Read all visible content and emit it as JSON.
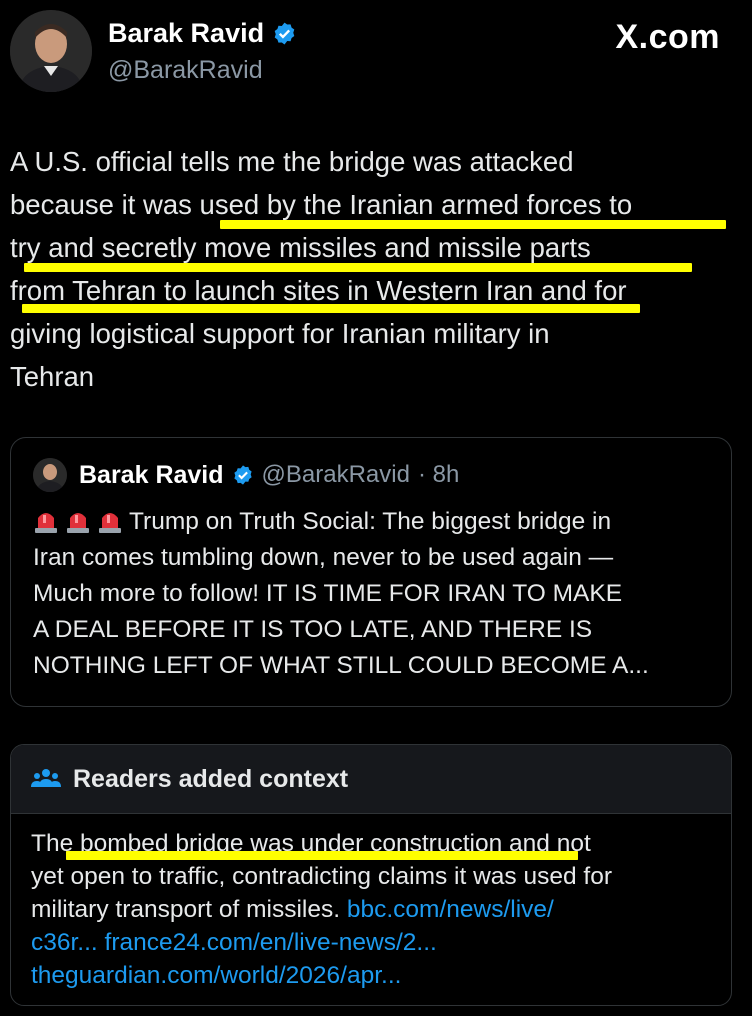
{
  "author": {
    "name": "Barak Ravid",
    "handle": "@BarakRavid"
  },
  "brand": "X.com",
  "tweet": {
    "lines": [
      "A U.S. official tells me the bridge was attacked",
      "because it was used by the Iranian armed forces to",
      "try and secretly move missiles and missile parts",
      "from Tehran to launch sites in Western Iran and for",
      "giving logistical support for Iranian military in",
      "Tehran"
    ]
  },
  "quote": {
    "name": "Barak Ravid",
    "handle": "@BarakRavid",
    "time": "· 8h",
    "first_line": "Trump on Truth Social: The biggest bridge in",
    "lines": [
      "Iran comes tumbling down, never to be used again —",
      "Much more to follow! IT IS TIME FOR IRAN TO MAKE",
      "A DEAL BEFORE IT IS TOO LATE, AND THERE IS",
      "NOTHING LEFT OF WHAT STILL COULD BECOME A..."
    ]
  },
  "community_note": {
    "title": "Readers added context",
    "line1": "The bombed bridge was under construction and not",
    "line2": "yet open to traffic, contradicting claims it was used for",
    "line3_text": "military transport of missiles. ",
    "link1": "bbc.com/news/live/",
    "link1_cont": "c36r...",
    "link2": "france24.com/en/live-news/2...",
    "link3": "theguardian.com/world/2026/apr..."
  },
  "colors": {
    "background": "#000000",
    "highlight": "#ffff00",
    "link": "#1d9bf0",
    "verified": "#1d9bf0"
  },
  "icons": [
    "verified-badge-icon",
    "siren-icon",
    "people-icon"
  ]
}
